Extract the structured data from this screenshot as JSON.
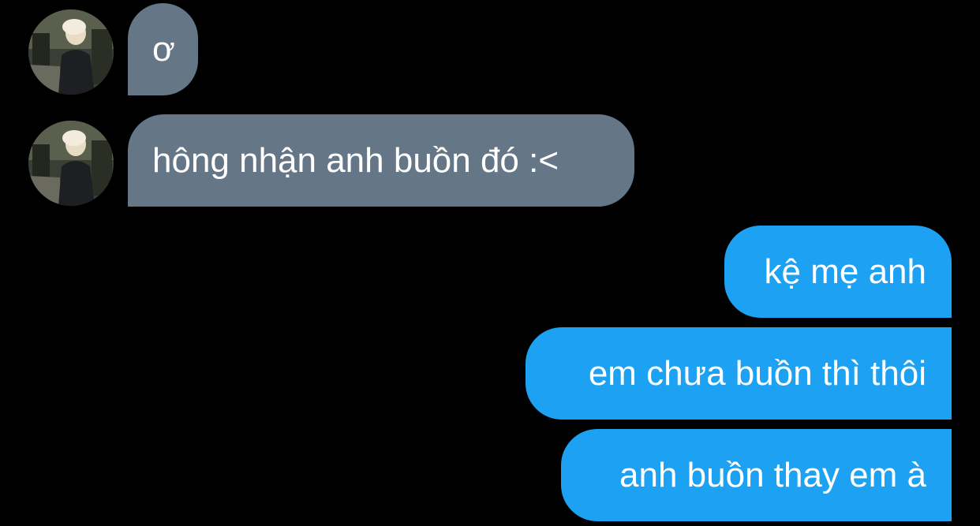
{
  "conversation": {
    "incoming": [
      {
        "text": "ơ",
        "avatar": "user-avatar"
      },
      {
        "text": "hông nhận anh buồn đó :<",
        "avatar": "user-avatar"
      }
    ],
    "outgoing": [
      {
        "text": "kệ mẹ anh"
      },
      {
        "text": "em chưa buồn thì thôi"
      },
      {
        "text": "anh buồn thay em à"
      }
    ]
  },
  "colors": {
    "background": "#000000",
    "incoming_bubble": "#657786",
    "outgoing_bubble": "#1da1f2",
    "text": "#ffffff"
  }
}
